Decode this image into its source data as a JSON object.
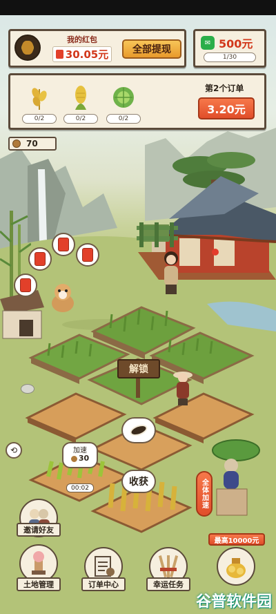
{
  "wallet": {
    "label": "我的红包",
    "amount": "30.05元",
    "withdraw_label": "全部提现"
  },
  "bonus": {
    "amount": "500元",
    "progress": "1/30"
  },
  "order": {
    "title": "第2个订单",
    "reward": "3.20元",
    "items": [
      {
        "icon": "wheat-icon",
        "progress": "0/2"
      },
      {
        "icon": "corn-icon",
        "progress": "0/2"
      },
      {
        "icon": "cabbage-icon",
        "progress": "0/2"
      }
    ]
  },
  "coins": {
    "count": "70"
  },
  "farm": {
    "unlock_sign": "解锁",
    "harvest_label": "收获",
    "speedup_label": "加速",
    "speedup_count": "30",
    "timer": "00:02",
    "all_speedup": "全体加速"
  },
  "max_reward": "最高10000元",
  "bottom_nav": [
    {
      "label": "邀请好友"
    },
    {
      "label": "土地管理"
    },
    {
      "label": "订单中心"
    },
    {
      "label": "幸运任务"
    }
  ],
  "watermark": "谷普软件园",
  "colors": {
    "panel_bg": "#f6efdf",
    "accent_orange": "#f0a83f",
    "accent_red": "#e14e2a",
    "money_red": "#d2381b"
  }
}
